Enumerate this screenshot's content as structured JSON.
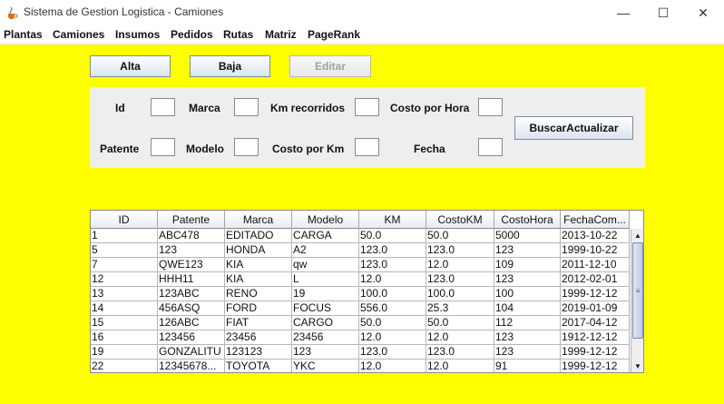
{
  "window": {
    "title": "Sistema de Gestion Logistica - Camiones",
    "minimize": "—",
    "maximize": "☐",
    "close": "✕"
  },
  "menu": [
    "Plantas",
    "Camiones",
    "Insumos",
    "Pedidos",
    "Rutas",
    "Matriz",
    "PageRank"
  ],
  "toolbar": {
    "alta": "Alta",
    "baja": "Baja",
    "editar": "Editar"
  },
  "form": {
    "id": "Id",
    "marca": "Marca",
    "km_recorridos": "Km recorridos",
    "costo_por_hora": "Costo por Hora",
    "patente": "Patente",
    "modelo": "Modelo",
    "costo_por_km": "Costo por Km",
    "fecha": "Fecha",
    "buscar": "BuscarActualizar"
  },
  "table": {
    "headers": [
      "ID",
      "Patente",
      "Marca",
      "Modelo",
      "KM",
      "CostoKM",
      "CostoHora",
      "FechaCom..."
    ],
    "rows": [
      [
        "1",
        "ABC478",
        "EDITADO",
        "CARGA",
        "50.0",
        "50.0",
        "5000",
        "2013-10-22"
      ],
      [
        "5",
        "123",
        "HONDA",
        "A2",
        "123.0",
        "123.0",
        "123",
        "1999-10-22"
      ],
      [
        "7",
        "QWE123",
        "KIA",
        "qw",
        "123.0",
        "12.0",
        "109",
        "2011-12-10"
      ],
      [
        "12",
        "HHH11",
        "KIA",
        "L",
        "12.0",
        "123.0",
        "123",
        "2012-02-01"
      ],
      [
        "13",
        "123ABC",
        "RENO",
        "19",
        "100.0",
        "100.0",
        "100",
        "1999-12-12"
      ],
      [
        "14",
        "456ASQ",
        "FORD",
        "FOCUS",
        "556.0",
        "25.3",
        "104",
        "2019-01-09"
      ],
      [
        "15",
        "126ABC",
        "FIAT",
        "CARGO",
        "50.0",
        "50.0",
        "112",
        "2017-04-12"
      ],
      [
        "16",
        "123456",
        "23456",
        "23456",
        "12.0",
        "12.0",
        "123",
        "1912-12-12"
      ],
      [
        "19",
        "GONZALITU",
        "123123",
        "123",
        "123.0",
        "123.0",
        "123",
        "1999-12-12"
      ],
      [
        "22",
        "12345678...",
        "TOYOTA",
        "YKC",
        "12.0",
        "12.0",
        "91",
        "1999-12-12"
      ]
    ]
  },
  "colors": {
    "background": "#ffff00",
    "panel": "#eeeeee"
  },
  "icons": {
    "app": "java-cup-icon",
    "scroll_up": "▲",
    "scroll_down": "▼",
    "scroll_grip": "≡"
  }
}
